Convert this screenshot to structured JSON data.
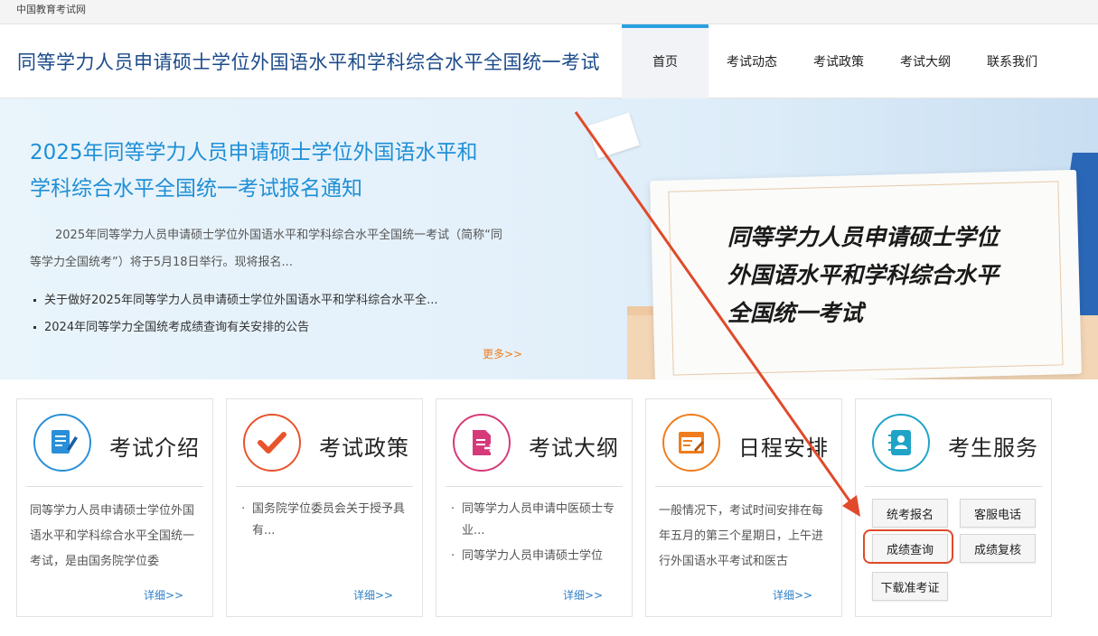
{
  "topbar": {
    "site_name": "中国教育考试网"
  },
  "header": {
    "title": "同等学力人员申请硕士学位外国语水平和学科综合水平全国统一考试",
    "nav": [
      "首页",
      "考试动态",
      "考试政策",
      "考试大纲",
      "联系我们"
    ]
  },
  "banner": {
    "title_line1": "2025年同等学力人员申请硕士学位外国语水平和",
    "title_line2": "学科综合水平全国统一考试报名通知",
    "desc": "2025年同等学力人员申请硕士学位外国语水平和学科综合水平全国统一考试（简称“同等学力全国统考”）将于5月18日举行。现将报名...",
    "links": [
      "关于做好2025年同等学力人员申请硕士学位外国语水平和学科综合水平全...",
      "2024年同等学力全国统考成绩查询有关安排的公告"
    ],
    "more": "更多>>",
    "card_line1": "同等学力人员申请硕士学位",
    "card_line2": "外国语水平和学科综合水平",
    "card_line3": "全国统一考试"
  },
  "cards": {
    "intro": {
      "title": "考试介绍",
      "body": "同等学力人员申请硕士学位外国语水平和学科综合水平全国统一考试，是由国务院学位委",
      "more": "详细>>",
      "icon": "document-edit-icon",
      "color": "#2a8fd8"
    },
    "policy": {
      "title": "考试政策",
      "items": [
        "国务院学位委员会关于授予具有..."
      ],
      "more": "详细>>",
      "icon": "checkmark-icon",
      "color": "#e8532c"
    },
    "syllabus": {
      "title": "考试大纲",
      "items": [
        "同等学力人员申请中医硕士专业...",
        "同等学力人员申请硕士学位"
      ],
      "more": "详细>>",
      "icon": "file-export-icon",
      "color": "#d63a78"
    },
    "schedule": {
      "title": "日程安排",
      "body": "一般情况下，考试时间安排在每年五月的第三个星期日，上午进行外国语水平考试和医古",
      "more": "详细>>",
      "icon": "calendar-edit-icon",
      "color": "#ef7d1e"
    },
    "services": {
      "title": "考生服务",
      "icon": "contact-book-icon",
      "color": "#1fa4c7",
      "buttons": [
        "统考报名",
        "客服电话",
        "成绩查询",
        "成绩复核",
        "下载准考证"
      ]
    }
  }
}
